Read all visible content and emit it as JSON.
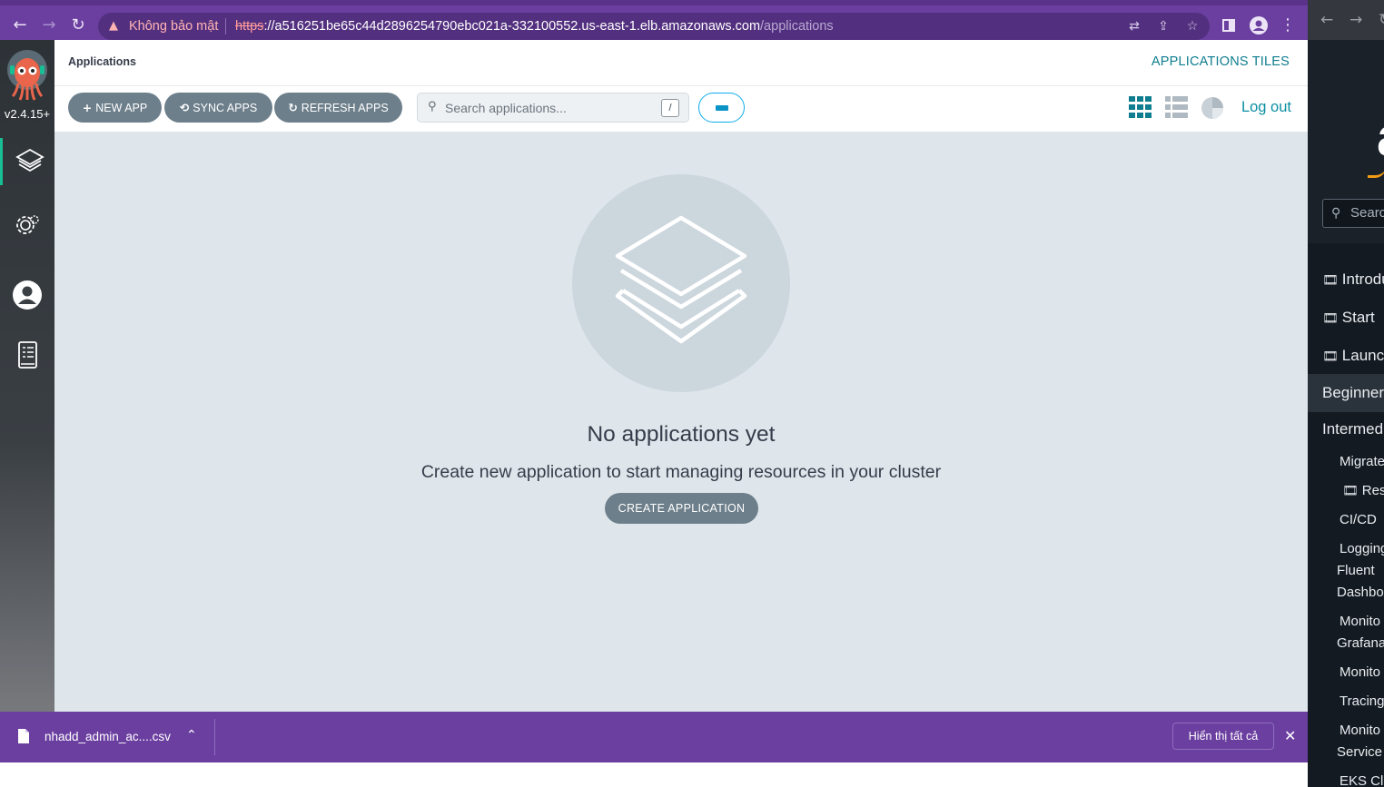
{
  "browser": {
    "security_label": "Không bảo mật",
    "url_scheme": "https",
    "url_host": "://a516251be65c44d2896254790ebc021a-332100552.us-east-1.elb.amazonaws.com",
    "url_path": "/applications"
  },
  "sidebar": {
    "version": "v2.4.15+",
    "items": [
      {
        "name": "applications",
        "icon": "layers-icon",
        "active": true
      },
      {
        "name": "settings",
        "icon": "gear-icon",
        "active": false
      },
      {
        "name": "user-info",
        "icon": "user-icon",
        "active": false
      },
      {
        "name": "docs",
        "icon": "book-icon",
        "active": false
      }
    ]
  },
  "header": {
    "title": "Applications",
    "view_name": "APPLICATIONS TILES"
  },
  "toolbar": {
    "new_app": "NEW APP",
    "sync_apps": "SYNC APPS",
    "refresh_apps": "REFRESH APPS",
    "search_placeholder": "Search applications...",
    "search_shortcut": "/",
    "logout": "Log out",
    "active_view": "tiles"
  },
  "empty_state": {
    "title": "No applications yet",
    "subtitle": "Create new application to start managing resources in your cluster",
    "create_button": "CREATE APPLICATION"
  },
  "downloads": {
    "file_name": "nhadd_admin_ac....csv",
    "show_all": "Hiển thị tất cả"
  },
  "right_window": {
    "search": "Search",
    "items": [
      {
        "label": "Introduction",
        "film": true
      },
      {
        "label": "Start",
        "film": true
      },
      {
        "label": "Launch",
        "film": true
      },
      {
        "label": "Beginner",
        "film": false
      },
      {
        "label": "Intermediate",
        "film": false
      },
      {
        "label": "Migrate",
        "film": false
      },
      {
        "label": "Res",
        "film": true
      },
      {
        "label": "CI/CD",
        "film": false
      },
      {
        "label": "Logging",
        "film": false
      },
      {
        "label": "Fluent",
        "film": false
      },
      {
        "label": "Dashbo",
        "film": false
      },
      {
        "label": "Monito",
        "film": false
      },
      {
        "label": "Grafana",
        "film": false
      },
      {
        "label": "Monito",
        "film": false
      },
      {
        "label": "Tracing",
        "film": false
      },
      {
        "label": "Monito",
        "film": false
      },
      {
        "label": "Service",
        "film": false
      },
      {
        "label": "EKS Cl",
        "film": false
      }
    ]
  },
  "colors": {
    "chrome_purple": "#6b3fa0",
    "argo_teal": "#0e7d8f",
    "button_gray": "#6d7f8b",
    "content_bg": "#dee6eb"
  }
}
